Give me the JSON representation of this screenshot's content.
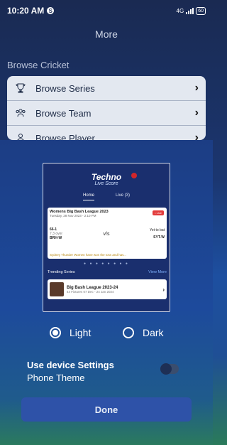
{
  "status_bar": {
    "time": "10:20 AM",
    "app_icon": "S",
    "network": "4G",
    "battery": "60"
  },
  "page_title": "More",
  "browse_section": {
    "title": "Browse Cricket",
    "items": [
      {
        "label": "Browse Series",
        "icon": "trophy-icon"
      },
      {
        "label": "Browse Team",
        "icon": "team-icon"
      },
      {
        "label": "Browse Player",
        "icon": "person-icon"
      }
    ]
  },
  "preview": {
    "logo_title": "Techno",
    "logo_sub": "Live Score",
    "tabs": [
      "Home",
      "Live (3)"
    ],
    "match": {
      "league": "Womens Big Bash League 2023",
      "date": "Tuesday, 28 Nov 2023 - 2:10 PM",
      "live": "• Live",
      "team_a_score": "66-1",
      "team_a_overs": "7.3 over",
      "team_a": "BRH-W",
      "vs": "v/s",
      "status": "Yet to bat",
      "team_b": "SYT-W",
      "note": "Sydney Thunder Women have won the toss and hav..."
    },
    "trending_label": "Trending Series",
    "view_more": "View More",
    "series": {
      "name": "Big Bash League 2023-24",
      "meta": "44 Fixtures 07 Dec - 24 Jan 2024"
    }
  },
  "theme": {
    "light": "Light",
    "dark": "Dark",
    "selected": "light"
  },
  "device_settings": {
    "line1": "Use device Settings",
    "line2": "Phone Theme"
  },
  "done_label": "Done"
}
